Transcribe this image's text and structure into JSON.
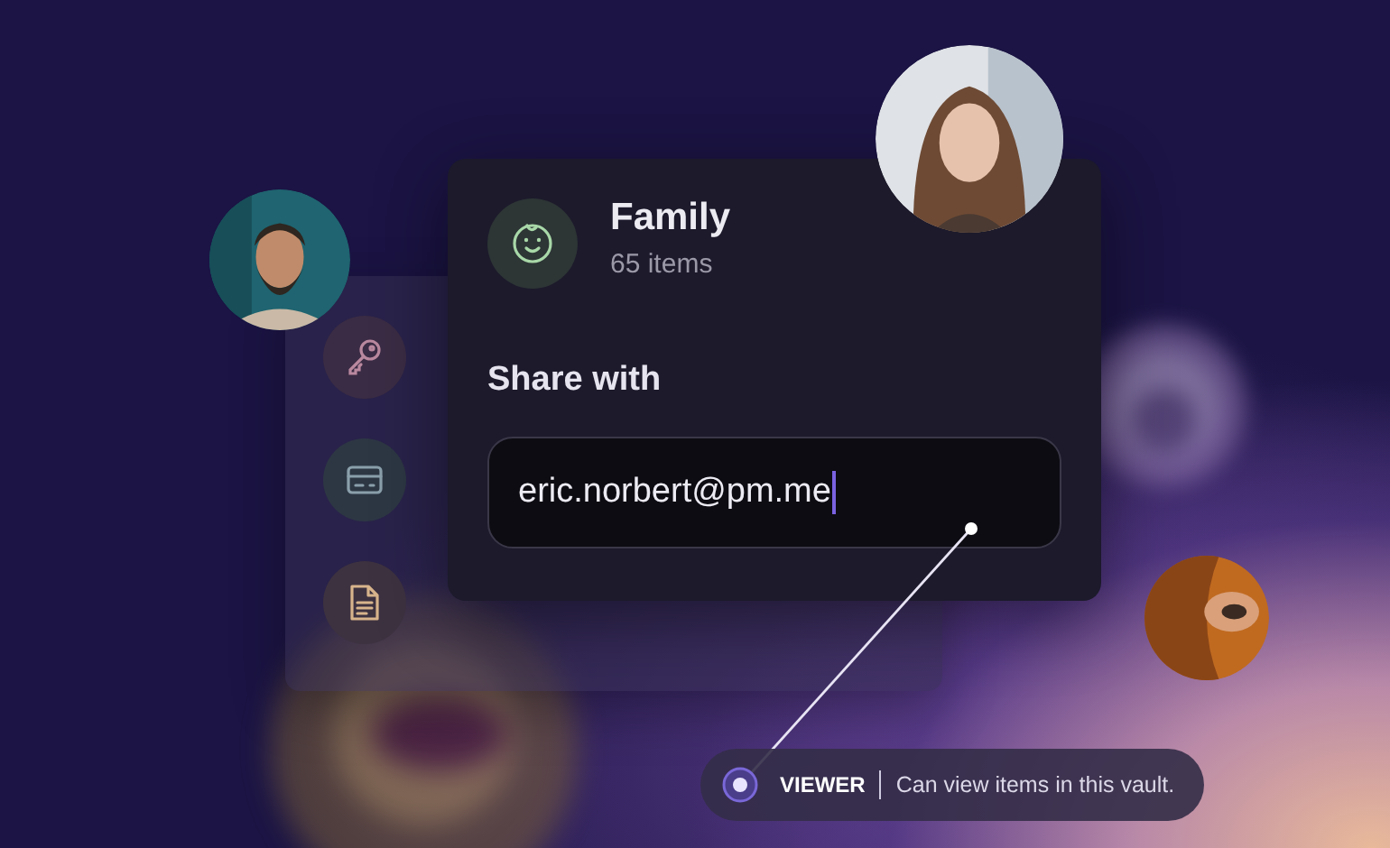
{
  "vault": {
    "name": "Family",
    "count": "65 items"
  },
  "share": {
    "label": "Share with",
    "value": "eric.norbert@pm.me"
  },
  "side_items": [
    {
      "kind": "key"
    },
    {
      "kind": "card"
    },
    {
      "kind": "note"
    }
  ],
  "role": {
    "name": "VIEWER",
    "description": "Can view items in this vault."
  }
}
